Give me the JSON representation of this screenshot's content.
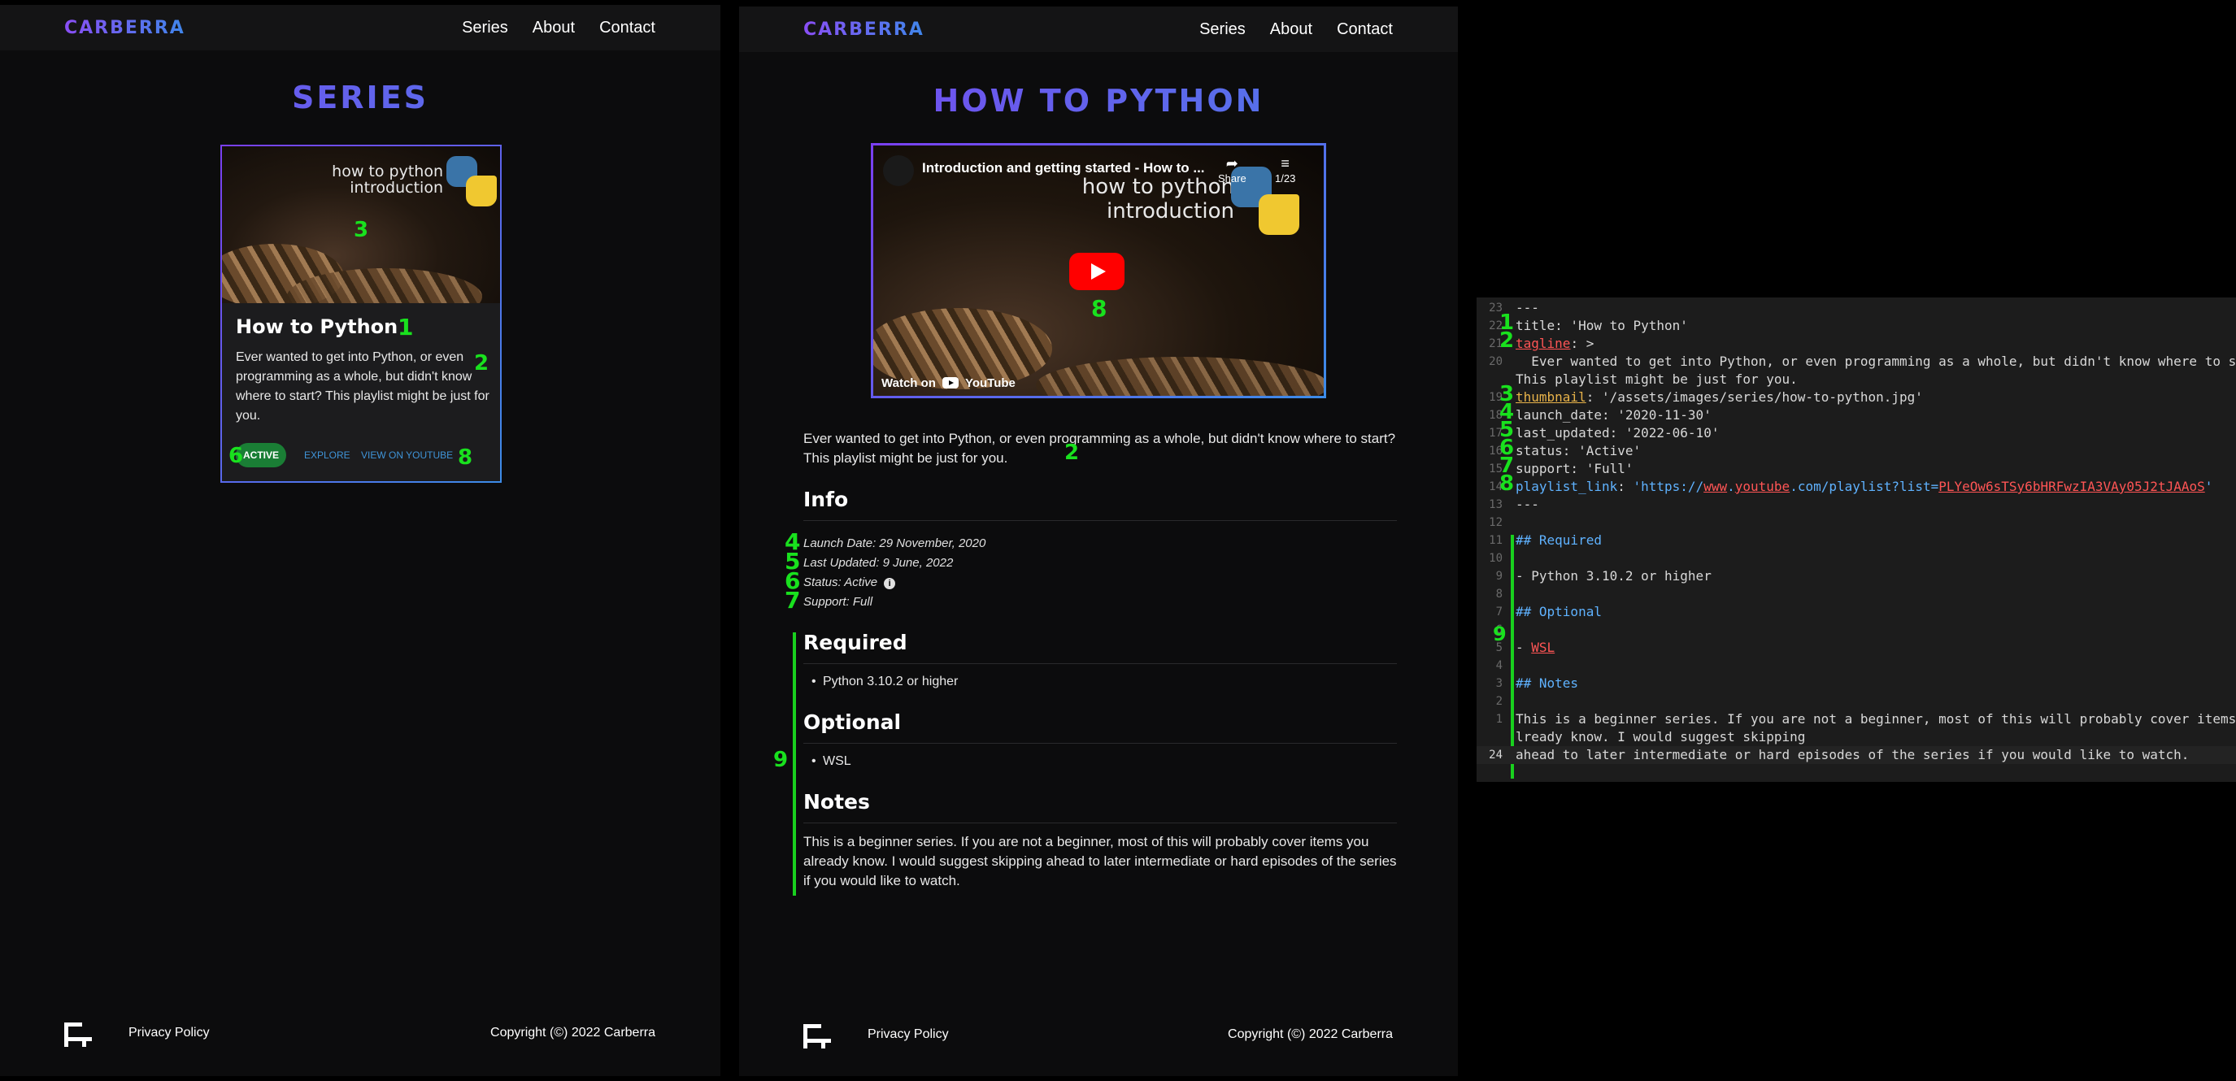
{
  "site": {
    "logo": "CARBERRA",
    "nav": [
      "Series",
      "About",
      "Contact"
    ],
    "footer_privacy": "Privacy Policy",
    "footer_copyright": "Copyright (©) 2022 Carberra"
  },
  "series_page": {
    "title": "SERIES",
    "card": {
      "thumb_line1": "how to python",
      "thumb_line2": "introduction",
      "title": "How to Python",
      "description": "Ever wanted to get into Python, or even programming as a whole, but didn't know where to start? This playlist might be just for you.",
      "status_badge": "ACTIVE",
      "explore_link": "EXPLORE",
      "youtube_link": "VIEW ON YOUTUBE"
    },
    "markers": {
      "thumb": "3",
      "title": "1",
      "desc": "2",
      "badge": "6",
      "yt": "8"
    }
  },
  "detail_page": {
    "title": "HOW TO PYTHON",
    "video": {
      "title": "Introduction and getting started - How to ...",
      "share": "Share",
      "queue": "1/23",
      "watch_on": "Watch on",
      "youtube": "YouTube",
      "thumb_line1": "how to python",
      "thumb_line2": "introduction"
    },
    "description": "Ever wanted to get into Python, or even programming as a whole, but didn't know where to start? This playlist might be just for you.",
    "info_heading": "Info",
    "launch_date": "Launch Date: 29 November, 2020",
    "last_updated": "Last Updated: 9 June, 2022",
    "status": "Status: Active",
    "support": "Support: Full",
    "required_heading": "Required",
    "required_items": [
      "Python 3.10.2 or higher"
    ],
    "optional_heading": "Optional",
    "optional_items": [
      "WSL"
    ],
    "notes_heading": "Notes",
    "notes": "This is a beginner series. If you are not a beginner, most of this will probably cover items you already know. I would suggest skipping ahead to later intermediate or hard episodes of the series if you would like to watch.",
    "markers": {
      "video": "8",
      "desc": "2",
      "launch": "4",
      "updated": "5",
      "status": "6",
      "support": "7",
      "body": "9"
    }
  },
  "editor": {
    "line_numbers": [
      "23",
      "22",
      "21",
      "20",
      "",
      "19",
      "18",
      "17",
      "16",
      "15",
      "14",
      "13",
      "12",
      "11",
      "10",
      "9",
      "8",
      "7",
      "6",
      "5",
      "4",
      "3",
      "2",
      "1",
      "",
      "24"
    ],
    "lines": [
      "---",
      "title: 'How to Python'",
      "tagline: >",
      "  Ever wanted to get into Python, or even programming as a whole, but didn't know where to start?",
      "This playlist might be just for you.",
      "thumbnail: '/assets/images/series/how-to-python.jpg'",
      "launch_date: '2020-11-30'",
      "last_updated: '2022-06-10'",
      "status: 'Active'",
      "support: 'Full'",
      "playlist_link: 'https://www.youtube.com/playlist?list=PLYeOw6sTSy6bHRFwzIA3VAy05J2tJAAoS'",
      "---",
      "",
      "## Required",
      "",
      "- Python 3.10.2 or higher",
      "",
      "## Optional",
      "",
      "- WSL",
      "",
      "## Notes",
      "",
      "This is a beginner series. If you are not a beginner, most of this will probably cover items you a",
      "lready know. I would suggest skipping",
      "ahead to later intermediate or hard episodes of the series if you would like to watch."
    ],
    "markers": [
      "1",
      "2",
      "3",
      "4",
      "5",
      "6",
      "7",
      "8",
      "9"
    ]
  },
  "colors": {
    "accent_purple": "#7a45f0",
    "accent_blue": "#4a7fe8",
    "marker_green": "#19e11e",
    "badge_green": "#1a7e35",
    "link_blue": "#3f94d8"
  }
}
